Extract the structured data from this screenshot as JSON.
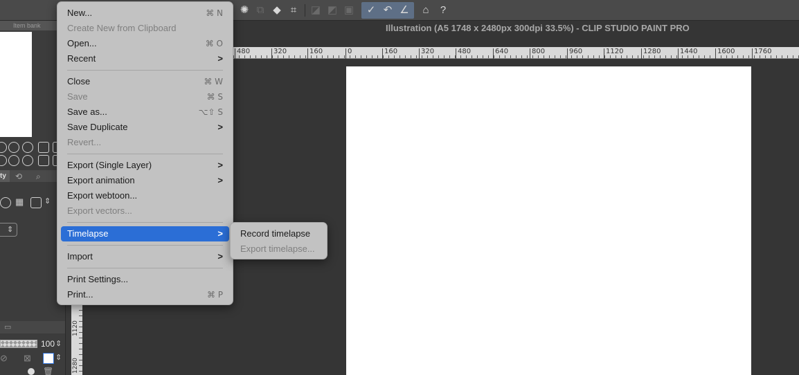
{
  "window": {
    "title": "Illustration (A5 1748 x 2480px 300dpi 33.5%)  - CLIP STUDIO PAINT PRO"
  },
  "left_panel": {
    "item_bank_tab": "Item bank",
    "property_tab_fragment": "ty",
    "opacity_value": "100"
  },
  "ruler_top": {
    "ticks": [
      "480",
      "320",
      "160",
      "0",
      "160",
      "320",
      "480",
      "640",
      "800",
      "960",
      "1120",
      "1280",
      "1440",
      "1600",
      "1760"
    ]
  },
  "ruler_left": {
    "ticks": [
      "1120",
      "1280"
    ]
  },
  "file_menu": {
    "items": [
      {
        "label": "New...",
        "shortcut": "⌘ N",
        "enabled": true
      },
      {
        "label": "Create New from Clipboard",
        "shortcut": "",
        "enabled": false
      },
      {
        "label": "Open...",
        "shortcut": "⌘ O",
        "enabled": true
      },
      {
        "label": "Recent",
        "submenu": true,
        "enabled": true
      },
      {
        "label": "Close",
        "shortcut": "⌘ W",
        "enabled": true
      },
      {
        "label": "Save",
        "shortcut": "⌘ S",
        "enabled": false
      },
      {
        "label": "Save as...",
        "shortcut": "⌥⇧ S",
        "enabled": true
      },
      {
        "label": "Save Duplicate",
        "submenu": true,
        "enabled": true
      },
      {
        "label": "Revert...",
        "shortcut": "",
        "enabled": false
      },
      {
        "label": "Export (Single Layer)",
        "submenu": true,
        "enabled": true
      },
      {
        "label": "Export animation",
        "submenu": true,
        "enabled": true
      },
      {
        "label": "Export webtoon...",
        "shortcut": "",
        "enabled": true
      },
      {
        "label": "Export vectors...",
        "shortcut": "",
        "enabled": false
      },
      {
        "label": "Timelapse",
        "submenu": true,
        "enabled": true,
        "highlighted": true
      },
      {
        "label": "Import",
        "submenu": true,
        "enabled": true
      },
      {
        "label": "Print Settings...",
        "shortcut": "",
        "enabled": true
      },
      {
        "label": "Print...",
        "shortcut": "⌘ P",
        "enabled": true
      }
    ],
    "arrow_glyph": ">"
  },
  "timelapse_submenu": {
    "items": [
      {
        "label": "Record timelapse",
        "enabled": true
      },
      {
        "label": "Export timelapse...",
        "enabled": false
      }
    ]
  },
  "colors": {
    "menu_background": "#c2c2c2",
    "highlight": "#2b6ed6",
    "canvas_background": "#353535",
    "paper": "#ffffff",
    "toolbar": "#4a4a4a"
  }
}
